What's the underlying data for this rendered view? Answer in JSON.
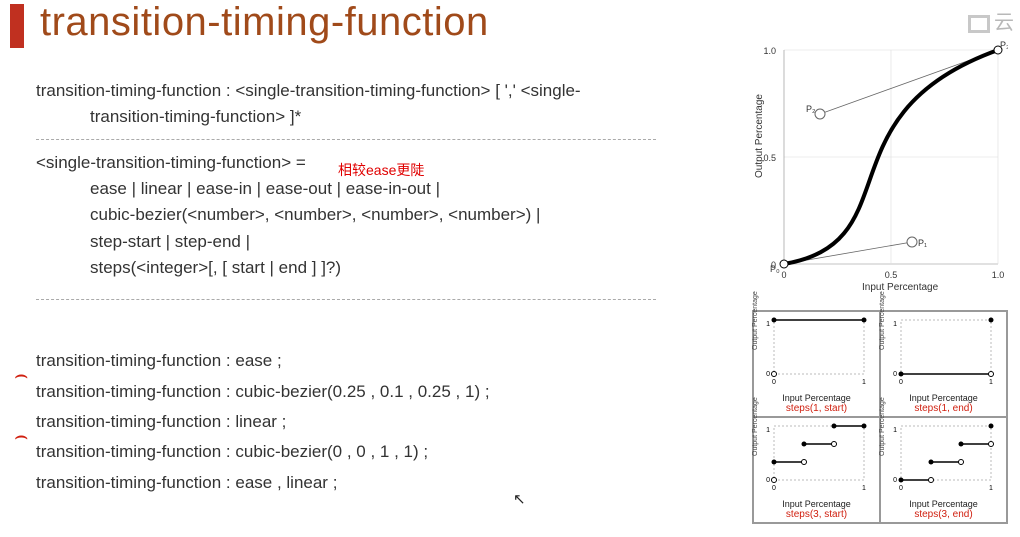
{
  "heading": "transition-timing-function",
  "watermark": "云",
  "syntax_main": {
    "line1": "transition-timing-function : <single-transition-timing-function> [ ',' <single-",
    "line2": "transition-timing-function> ]*"
  },
  "syntax_def": {
    "head": "<single-transition-timing-function> =",
    "row1": "ease | linear | ease-in | ease-out | ease-in-out |",
    "row2": "cubic-bezier(<number>, <number>, <number>, <number>) |",
    "row3": "step-start | step-end |",
    "row4": "steps(<integer>[, [ start | end ] ]?)"
  },
  "annotation": "相较ease更陡",
  "examples": {
    "e1": "transition-timing-function : ease ;",
    "e2": "transition-timing-function : cubic-bezier(0.25 , 0.1 , 0.25 , 1) ;",
    "e3": "transition-timing-function : linear ;",
    "e4": "transition-timing-function : cubic-bezier(0 , 0 , 1 , 1) ;",
    "e5": "transition-timing-function : ease , linear ;"
  },
  "chart_data": {
    "type": "line",
    "title": "",
    "xlabel": "Input Percentage",
    "ylabel": "Output Percentage",
    "xlim": [
      0,
      1
    ],
    "ylim": [
      0,
      1
    ],
    "xticks": [
      0,
      0.5,
      1.0
    ],
    "yticks": [
      0,
      0.5,
      1.0
    ],
    "control_points": {
      "P0": [
        0,
        0
      ],
      "P1": [
        0.6,
        0.1
      ],
      "P2": [
        0.17,
        0.7
      ],
      "P3": [
        1,
        1
      ]
    },
    "curve_type": "cubic-bezier",
    "curve_params": [
      0.6,
      0.1,
      0.17,
      0.7
    ]
  },
  "steps_panels": [
    {
      "caption": "steps(1, start)",
      "xlabel": "Input Percentage",
      "ylabel": "Output Percentage",
      "steps": 1,
      "mode": "start"
    },
    {
      "caption": "steps(1, end)",
      "xlabel": "Input Percentage",
      "ylabel": "Output Percentage",
      "steps": 1,
      "mode": "end"
    },
    {
      "caption": "steps(3, start)",
      "xlabel": "Input Percentage",
      "ylabel": "Output Percentage",
      "steps": 3,
      "mode": "start"
    },
    {
      "caption": "steps(3, end)",
      "xlabel": "Input Percentage",
      "ylabel": "Output Percentage",
      "steps": 3,
      "mode": "end"
    }
  ]
}
